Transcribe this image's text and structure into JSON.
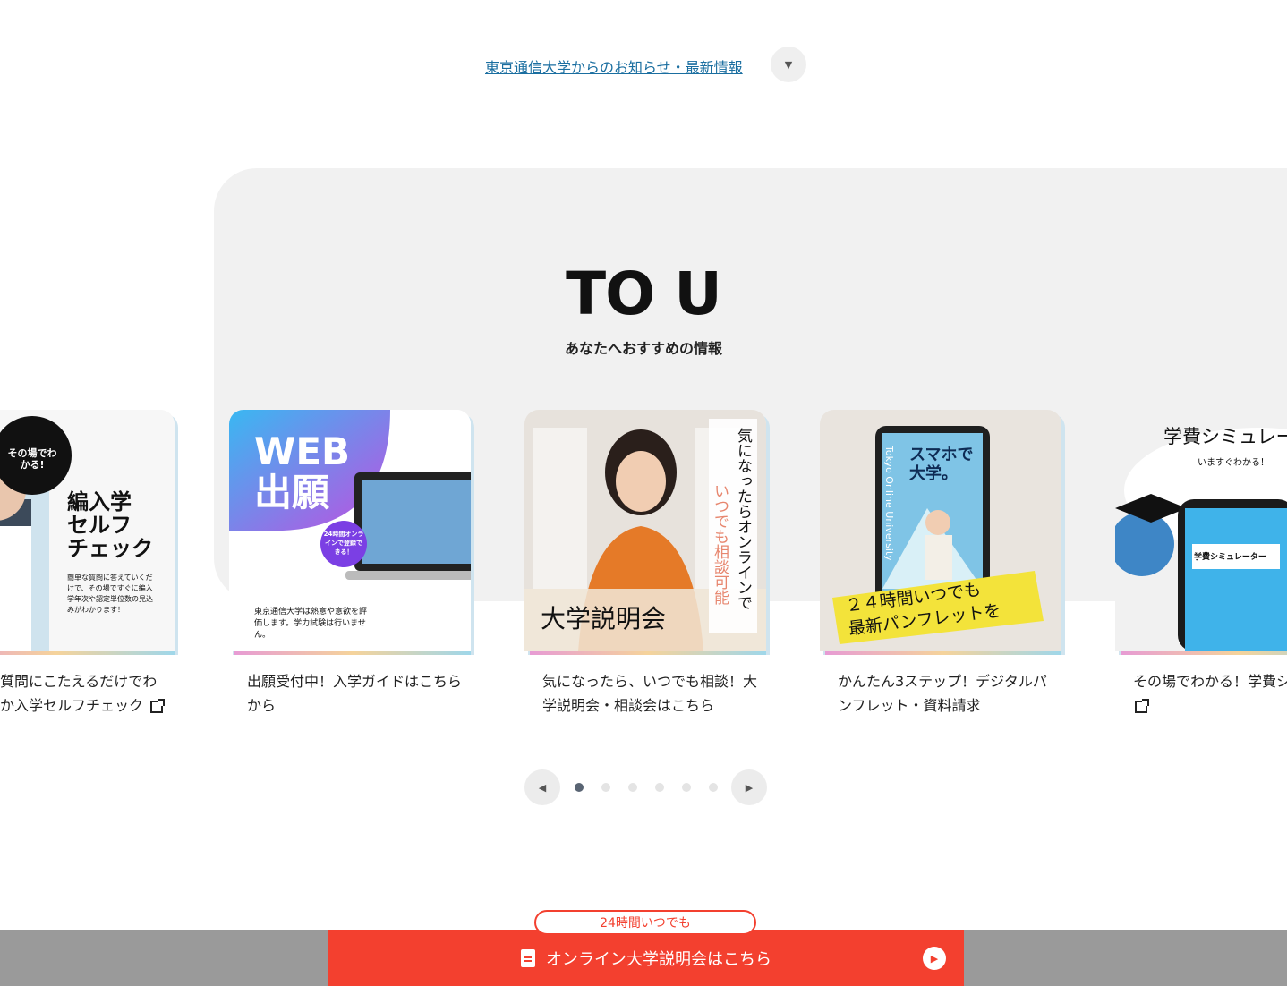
{
  "news": {
    "link_label": "東京通信大学からのお知らせ・最新情報",
    "toggle_icon": "▼"
  },
  "section": {
    "title": "TO U",
    "subtitle": "あなたへおすすめの情報"
  },
  "cards": [
    {
      "text": "質問にこたえるだけでわか入学セルフチェック",
      "image_title": "編入学\nセルフ\nチェック",
      "image_badge": "その場でわかる!",
      "image_note": "簡単な質問に答えていくだけで、その場ですぐに編入学年次や認定単位数の見込みがわかります！",
      "external": true
    },
    {
      "text": "出願受付中！入学ガイドはこちらから",
      "image_title": "WEB\n出願",
      "image_badge": "24時間オンラインで登録できる！",
      "image_note": "東京通信大学は熱意や意欲を評価します。学力試験は行いません。",
      "external": false
    },
    {
      "text": "気になったら、いつでも相談！大学説明会・相談会はこちら",
      "image_title": "大学説明会",
      "image_badge": "気になったらオンラインで",
      "image_note": "いつでも相談可能",
      "external": false
    },
    {
      "text": "かんたん3ステップ！デジタルパンフレット・資料請求",
      "image_title": "２４時間いつでも\n最新パンフレットを",
      "image_badge": "スマホで大学。",
      "image_note": "Tokyo Online University",
      "external": false
    },
    {
      "text": "その場でわかる！学費シ",
      "image_title": "学費シミュレー",
      "image_badge": "いますぐわかる！",
      "image_note": "学費シミュレーター",
      "external": true
    }
  ],
  "pager": {
    "prev_icon": "◀",
    "next_icon": "▶",
    "pages": 6,
    "active": 0
  },
  "cta": {
    "badge": "24時間いつでも",
    "label": "オンライン大学説明会はこちら",
    "play_icon": "▶"
  },
  "colors": {
    "accent": "#f3402f",
    "link": "#1a6ea0",
    "panel": "#f1f1f1"
  }
}
